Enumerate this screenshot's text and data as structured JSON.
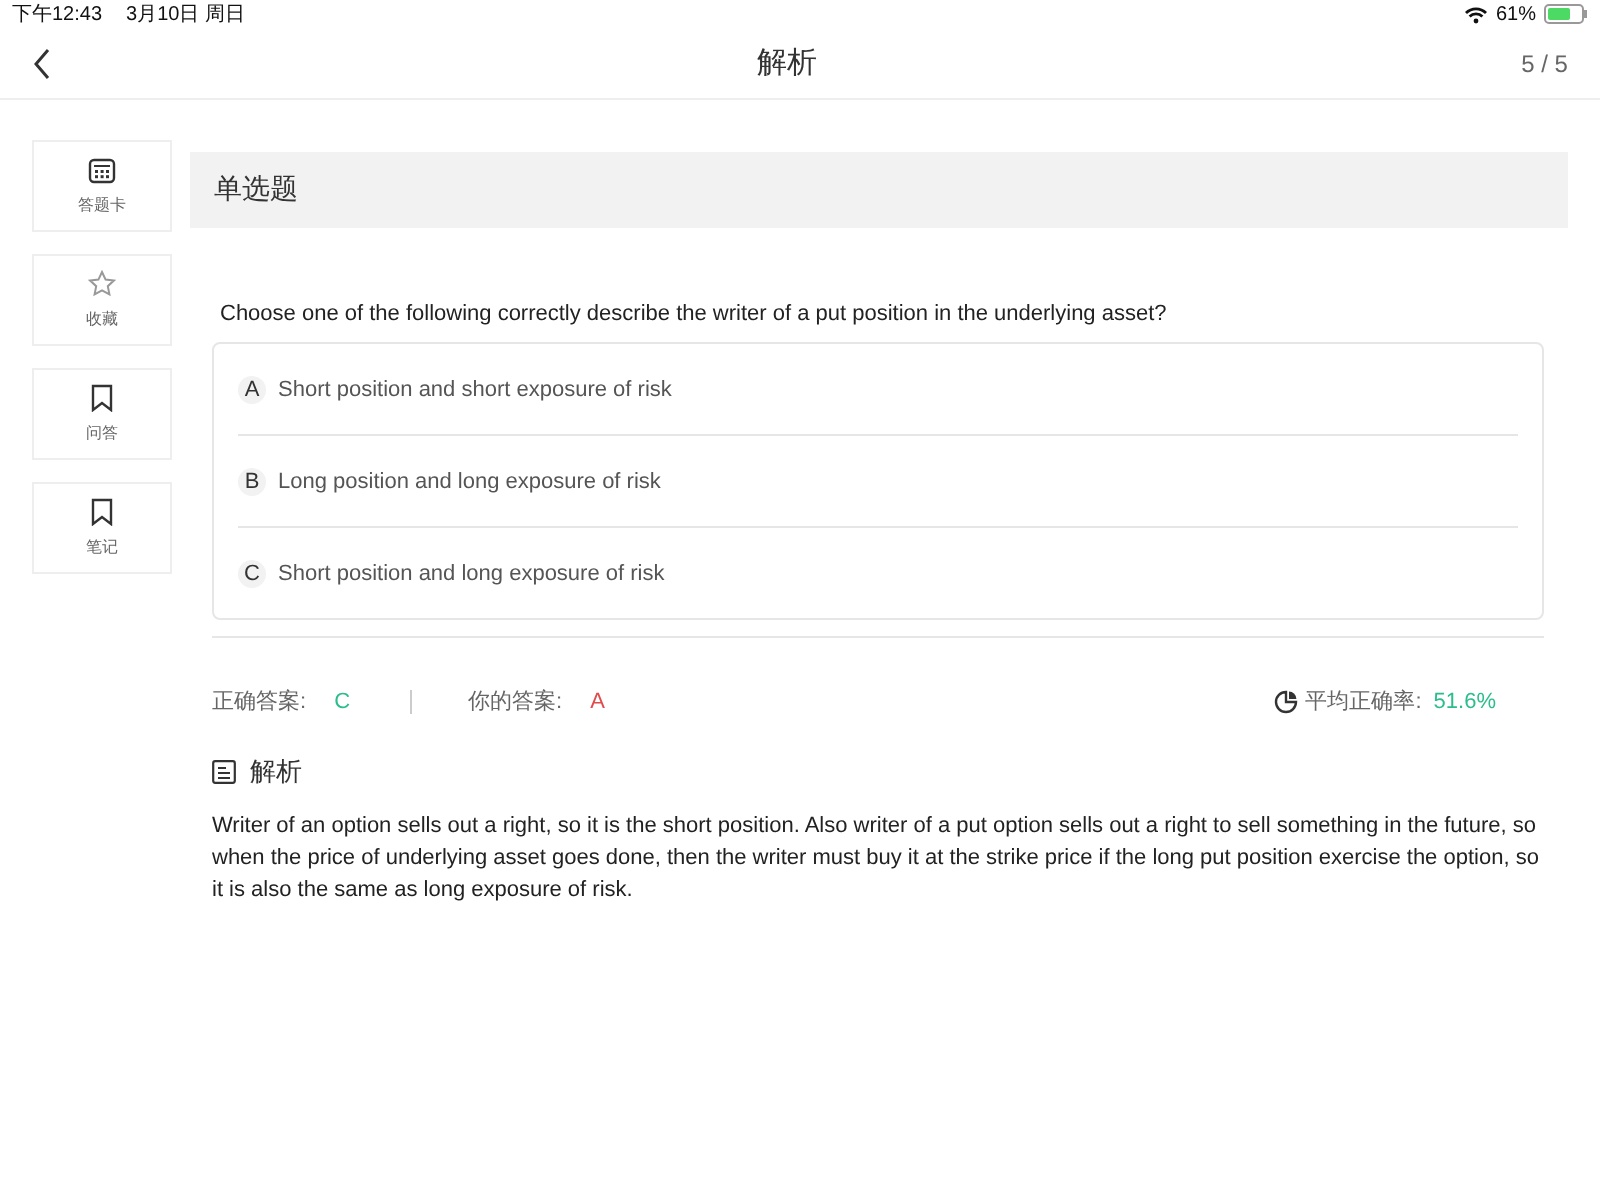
{
  "status_bar": {
    "time": "下午12:43",
    "date": "3月10日 周日",
    "battery": "61%"
  },
  "nav": {
    "title": "解析",
    "progress": "5 / 5"
  },
  "sidebar": {
    "items": [
      {
        "kind": "card",
        "label": "答题卡"
      },
      {
        "kind": "star",
        "label": "收藏"
      },
      {
        "kind": "bookmark",
        "label": "问答"
      },
      {
        "kind": "bookmark",
        "label": "笔记"
      }
    ]
  },
  "question": {
    "type": "单选题",
    "text": "Choose one of the following correctly describe the writer of a put position in the underlying asset?",
    "options": [
      {
        "letter": "A",
        "text": "Short position and short exposure of risk"
      },
      {
        "letter": "B",
        "text": "Long position and long exposure of risk"
      },
      {
        "letter": "C",
        "text": "Short position and long exposure of risk"
      }
    ]
  },
  "result": {
    "correct_label": "正确答案:",
    "correct": "C",
    "yours_label": "你的答案:",
    "yours": "A",
    "average_label": "平均正确率:",
    "average": "51.6%"
  },
  "explanation": {
    "title": "解析",
    "text": "Writer of an option sells out a right, so it is the short position. Also writer of a put option sells out a right to sell something in the future, so when the price of underlying asset goes done, then the writer must buy it at the strike price if the long put position exercise the option, so it is also the same as long exposure of risk."
  }
}
